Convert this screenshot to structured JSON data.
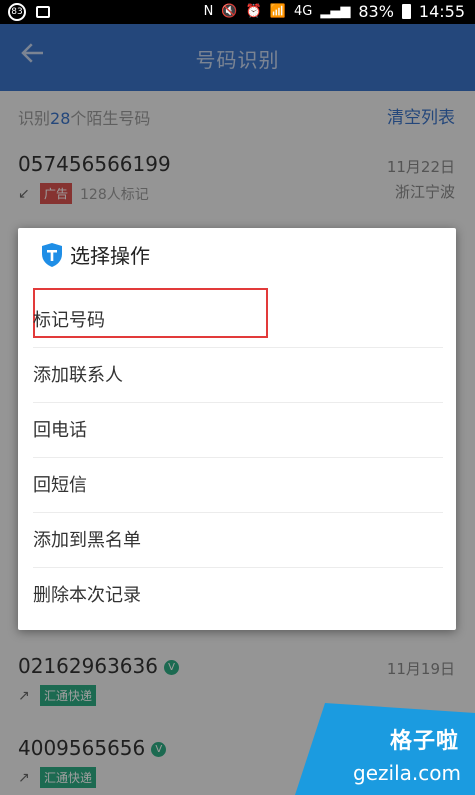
{
  "status_bar": {
    "badge": "83",
    "battery": "83%",
    "time": "14:55",
    "network": "4G"
  },
  "app_bar": {
    "title": "号码识别"
  },
  "summary": {
    "prefix": "识别",
    "count": "28",
    "suffix": "个陌生号码",
    "clear_label": "清空列表"
  },
  "calls": [
    {
      "number": "057456566199",
      "tag": "广告",
      "mark_count": "128人标记",
      "date": "11月22日",
      "location": "浙江宁波"
    },
    {
      "number": "02162963636",
      "tag": "汇通快递",
      "date": "11月19日"
    },
    {
      "number": "4009565656",
      "tag": "汇通快递"
    }
  ],
  "dialog": {
    "title": "选择操作",
    "options": [
      "标记号码",
      "添加联系人",
      "回电话",
      "回短信",
      "添加到黑名单",
      "删除本次记录"
    ]
  },
  "watermark": {
    "line1": "格子啦",
    "line2": "gezila.com"
  },
  "colors": {
    "primary": "#3a73c7",
    "tag_red": "#d9534f",
    "tag_green": "#2eab83",
    "highlight": "#e23a3a"
  }
}
